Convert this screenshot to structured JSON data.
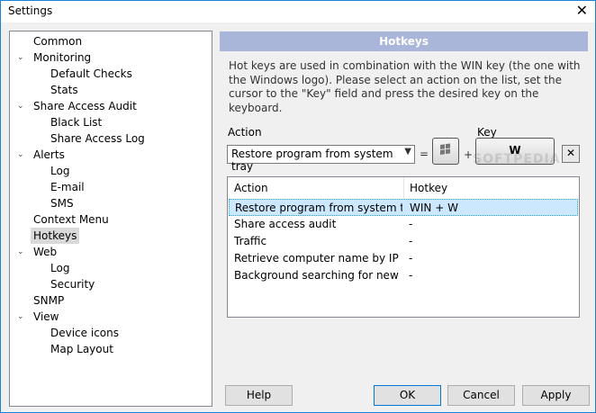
{
  "window": {
    "title": "Settings",
    "close_glyph": "✕"
  },
  "tree": {
    "items": [
      {
        "label": "Common",
        "level": 0,
        "expander": ""
      },
      {
        "label": "Monitoring",
        "level": 0,
        "expander": "v"
      },
      {
        "label": "Default Checks",
        "level": 1,
        "expander": ""
      },
      {
        "label": "Stats",
        "level": 1,
        "expander": ""
      },
      {
        "label": "Share Access Audit",
        "level": 0,
        "expander": "v"
      },
      {
        "label": "Black List",
        "level": 1,
        "expander": ""
      },
      {
        "label": "Share Access Log",
        "level": 1,
        "expander": ""
      },
      {
        "label": "Alerts",
        "level": 0,
        "expander": "v"
      },
      {
        "label": "Log",
        "level": 1,
        "expander": ""
      },
      {
        "label": "E-mail",
        "level": 1,
        "expander": ""
      },
      {
        "label": "SMS",
        "level": 1,
        "expander": ""
      },
      {
        "label": "Context Menu",
        "level": 0,
        "expander": ""
      },
      {
        "label": "Hotkeys",
        "level": 0,
        "expander": "",
        "selected": true
      },
      {
        "label": "Web",
        "level": 0,
        "expander": "v"
      },
      {
        "label": "Log",
        "level": 1,
        "expander": ""
      },
      {
        "label": "Security",
        "level": 1,
        "expander": ""
      },
      {
        "label": "SNMP",
        "level": 0,
        "expander": ""
      },
      {
        "label": "View",
        "level": 0,
        "expander": "v"
      },
      {
        "label": "Device icons",
        "level": 1,
        "expander": ""
      },
      {
        "label": "Map Layout",
        "level": 1,
        "expander": ""
      }
    ]
  },
  "panel": {
    "header": "Hotkeys",
    "description": "Hot keys are used in combination with the WIN key (the one with the Windows logo). Please select an action on the list, set the cursor to the \"Key\" field and press the desired key on the keyboard.",
    "action_label": "Action",
    "key_label": "Key",
    "combo_value": "Restore program from system tray",
    "equals": "=",
    "plus": "+",
    "key_value": "W",
    "clear_glyph": "✕",
    "watermark": "SOFTPEDIA"
  },
  "list": {
    "columns": [
      "Action",
      "Hotkey"
    ],
    "rows": [
      {
        "action": "Restore program from system tray",
        "hotkey": "WIN + W",
        "selected": true
      },
      {
        "action": "Share access audit",
        "hotkey": "-"
      },
      {
        "action": "Traffic",
        "hotkey": "-"
      },
      {
        "action": "Retrieve computer name by IP",
        "hotkey": "-"
      },
      {
        "action": "Background searching for new h...",
        "hotkey": "-"
      }
    ]
  },
  "buttons": {
    "help": "Help",
    "ok": "OK",
    "cancel": "Cancel",
    "apply": "Apply"
  }
}
